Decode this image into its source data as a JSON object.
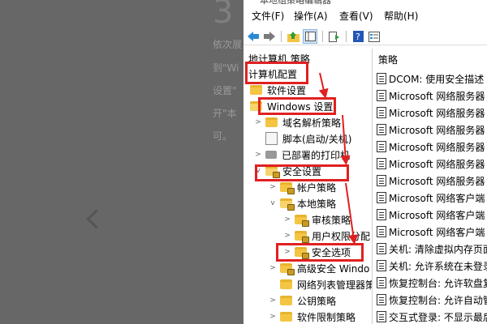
{
  "background_article": {
    "big_number": "3",
    "lines": [
      "依次展",
      "到\"Wi",
      "设置\"",
      "开\"本",
      "可。"
    ]
  },
  "window": {
    "title_fragment": "本地组策略编辑器",
    "menu": [
      "文件(F)",
      "操作(A)",
      "查看(V)",
      "帮助(H)"
    ],
    "toolbar_icons": [
      "back-arrow-icon",
      "forward-arrow-icon",
      "up-folder-icon",
      "show-hide-tree-icon",
      "export-list-icon",
      "help-icon",
      "properties-icon"
    ]
  },
  "tree": {
    "nodes": [
      {
        "label": "地计算机 策略",
        "indent": 0,
        "twisty": "",
        "icon": "none"
      },
      {
        "label": "计算机配置",
        "indent": 0,
        "twisty": "",
        "icon": "none"
      },
      {
        "label": "软件设置",
        "indent": 1,
        "twisty": "",
        "icon": "folder"
      },
      {
        "label": "Windows 设置",
        "indent": 1,
        "twisty": "",
        "icon": "folder-open"
      },
      {
        "label": "域名解析策略",
        "indent": 2,
        "twisty": ">",
        "icon": "folder"
      },
      {
        "label": "脚本(启动/关机)",
        "indent": 2,
        "twisty": "",
        "icon": "script"
      },
      {
        "label": "已部署的打印机",
        "indent": 2,
        "twisty": ">",
        "icon": "printer"
      },
      {
        "label": "安全设置",
        "indent": 2,
        "twisty": "v",
        "icon": "folder-lock"
      },
      {
        "label": "帐户策略",
        "indent": 3,
        "twisty": ">",
        "icon": "folder-lock"
      },
      {
        "label": "本地策略",
        "indent": 3,
        "twisty": "v",
        "icon": "folder-lock"
      },
      {
        "label": "审核策略",
        "indent": 4,
        "twisty": ">",
        "icon": "folder-lock"
      },
      {
        "label": "用户权限分配",
        "indent": 4,
        "twisty": ">",
        "icon": "folder-lock"
      },
      {
        "label": "安全选项",
        "indent": 4,
        "twisty": ">",
        "icon": "folder-lock"
      },
      {
        "label": "高级安全 Windo",
        "indent": 3,
        "twisty": ">",
        "icon": "folder-lock"
      },
      {
        "label": "网络列表管理器策",
        "indent": 3,
        "twisty": "",
        "icon": "folder"
      },
      {
        "label": "公钥策略",
        "indent": 3,
        "twisty": ">",
        "icon": "folder"
      },
      {
        "label": "软件限制策略",
        "indent": 3,
        "twisty": ">",
        "icon": "folder"
      }
    ]
  },
  "list": {
    "header": "策略",
    "items": [
      "DCOM: 使用安全描述",
      "Microsoft 网络服务器",
      "Microsoft 网络服务器",
      "Microsoft 网络服务器",
      "Microsoft 网络服务器",
      "Microsoft 网络服务器",
      "Microsoft 网络服务器",
      "Microsoft 网络客户端",
      "Microsoft 网络客户端",
      "Microsoft 网络客户端",
      "关机: 清除虚拟内存页面",
      "关机: 允许系统在未登录",
      "恢复控制台: 允许软盘复",
      "恢复控制台: 允许自动管",
      "交互式登录: 不显示最后"
    ]
  },
  "colors": {
    "highlight": "#e02020",
    "folder": "#f4c542",
    "overlay": "#676767"
  }
}
